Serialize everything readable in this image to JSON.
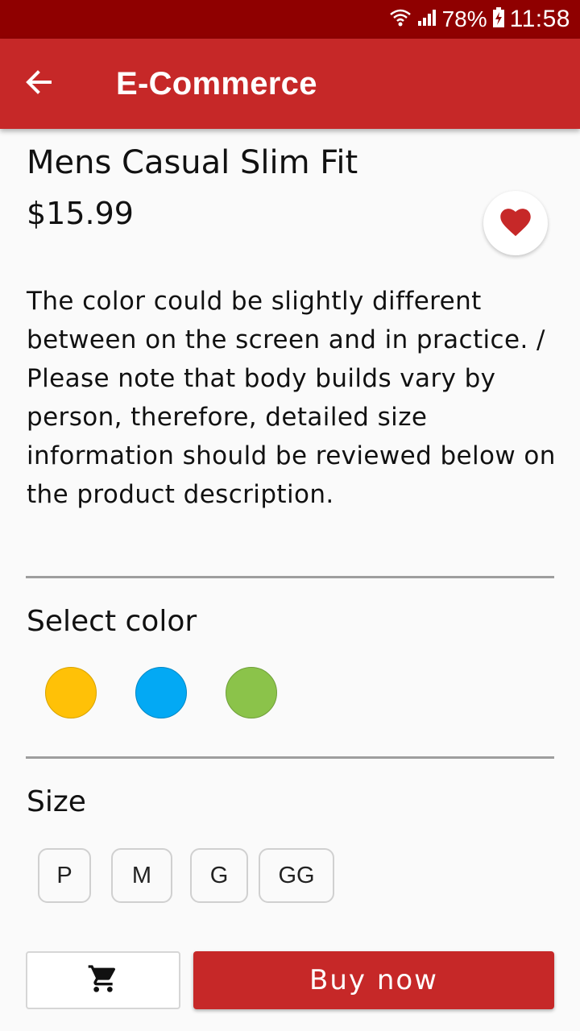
{
  "status_bar": {
    "battery_percent": "78%",
    "time": "11:58",
    "icons": [
      "wifi-icon",
      "signal-icon",
      "battery-charging-icon"
    ]
  },
  "app_bar": {
    "title": "E-Commerce",
    "back_icon": "arrow-back-icon"
  },
  "product": {
    "name": "Mens Casual Slim Fit",
    "price": "$15.99",
    "favorite_icon": "heart-icon",
    "description": "The color could be slightly different between on the screen and in practice. / Please note that body builds vary by person, therefore, detailed size information should be reviewed below on the product description."
  },
  "color_section": {
    "title": "Select color",
    "colors": [
      "#FFC107",
      "#03A9F4",
      "#8BC34A"
    ]
  },
  "size_section": {
    "title": "Size",
    "sizes": [
      "P",
      "M",
      "G",
      "GG"
    ]
  },
  "actions": {
    "cart_icon": "cart-icon",
    "buy_label": "Buy now"
  },
  "theme": {
    "primary": "#C62828",
    "status_bar": "#8F0000",
    "background": "#FAFAFA"
  }
}
